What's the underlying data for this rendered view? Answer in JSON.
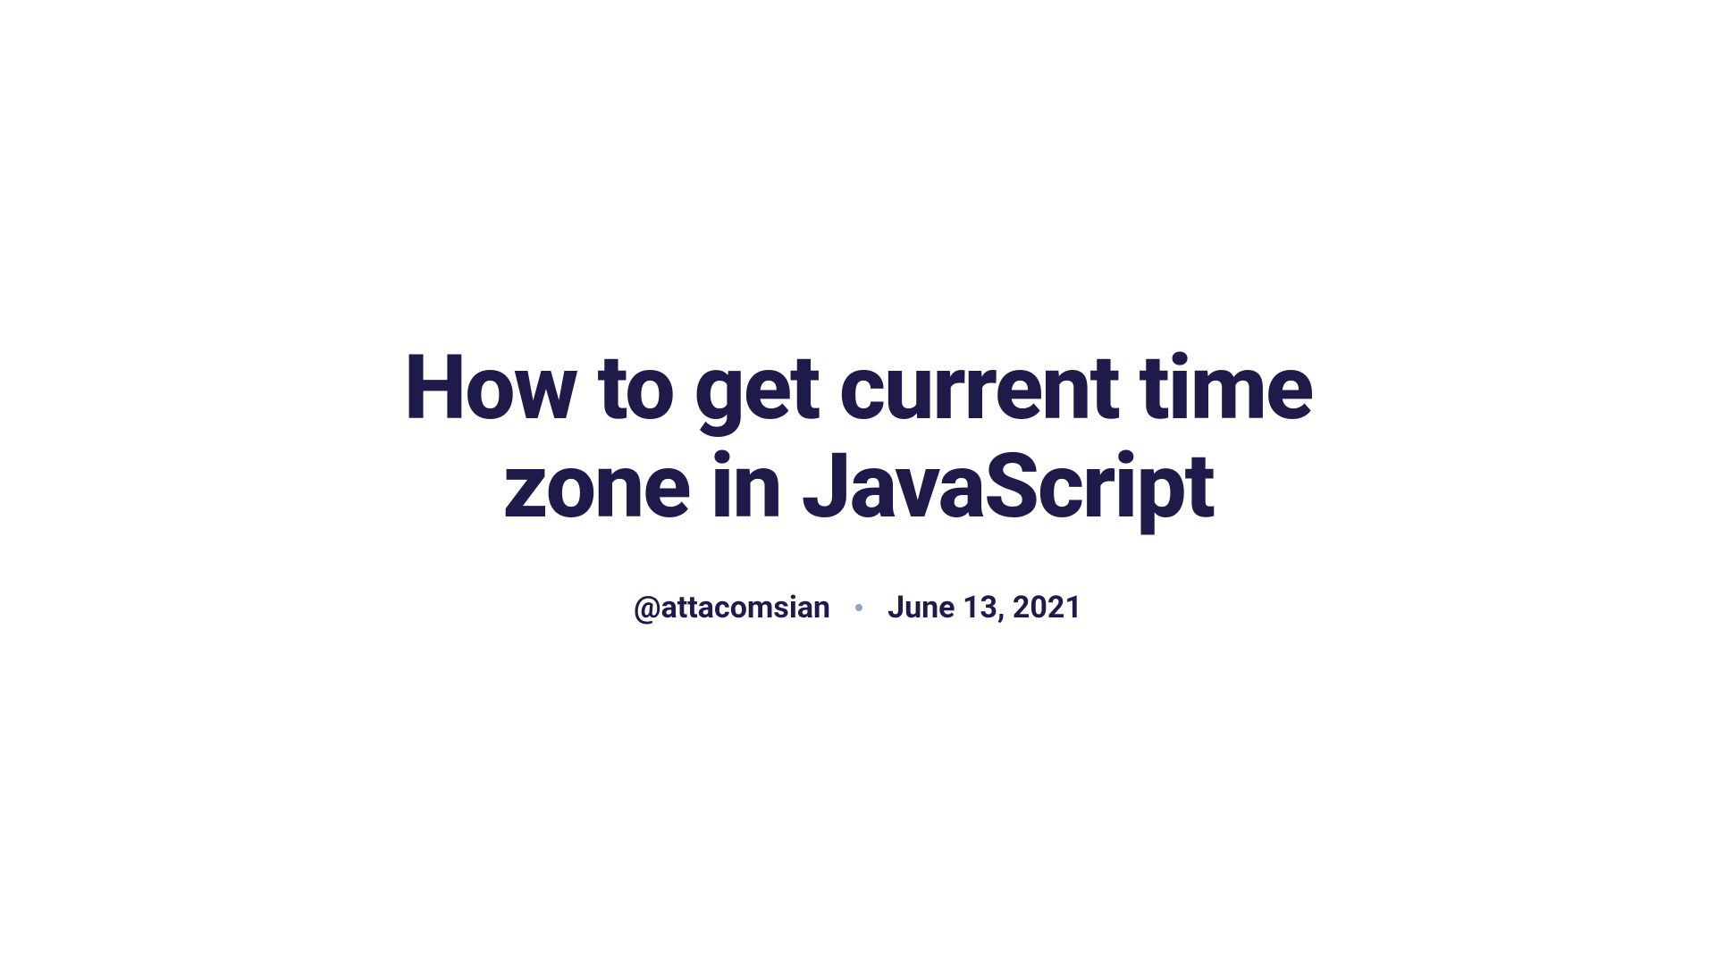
{
  "article": {
    "title": "How to get current time zone in JavaScript",
    "author": "@attacomsian",
    "date": "June 13, 2021"
  }
}
